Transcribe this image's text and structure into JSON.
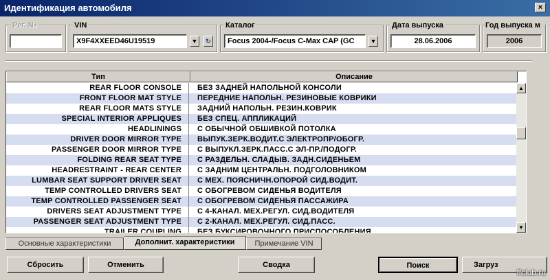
{
  "window": {
    "title": "Идентификация автомобиля",
    "close_glyph": "×"
  },
  "fields": {
    "reg_label": "Рег. №",
    "reg_value": "",
    "vin_label": "VIN",
    "vin_value": "X9F4XXEED46U19519",
    "catalog_label": "Каталог",
    "catalog_value": "Focus 2004-/Focus C-Max CAP (GC",
    "date_label": "Дата выпуска",
    "date_value": "28.06.2006",
    "year_label": "Год выпуска м",
    "year_value": "2006"
  },
  "grid": {
    "columns": [
      "Тип",
      "Описание"
    ],
    "rows": [
      [
        "REAR FLOOR CONSOLE",
        "БЕЗ ЗАДНЕЙ НАПОЛЬНОЙ КОНСОЛИ"
      ],
      [
        "FRONT FLOOR MAT STYLE",
        "ПЕРЕДНИЕ НАПОЛЬН. РЕЗИНОВЫЕ КОВРИКИ"
      ],
      [
        "REAR FLOOR MATS STYLE",
        "ЗАДНИЙ НАПОЛЬН. РЕЗИН.КОВРИК"
      ],
      [
        "SPECIAL INTERIOR APPLIQUES",
        "БЕЗ СПЕЦ. АППЛИКАЦИЙ"
      ],
      [
        "HEADLININGS",
        "С ОБЫЧНОЙ ОБШИВКОЙ ПОТОЛКА"
      ],
      [
        "DRIVER DOOR MIRROR TYPE",
        "ВЫПУК.ЗЕРК.ВОДИТ.С ЭЛЕКТРОПР/ОБОГР."
      ],
      [
        "PASSENGER DOOR MIRROR TYPE",
        "С ВЫПУКЛ.ЗЕРК.ПАСС.С ЭЛ-ПР./ПОДОГР."
      ],
      [
        "FOLDING REAR SEAT TYPE",
        "С РАЗДЕЛЬН. СЛАДЫВ. ЗАДН.СИДЕНЬЕМ"
      ],
      [
        "HEADRESTRAINT - REAR CENTER",
        "С ЗАДНИМ ЦЕНТРАЛЬН. ПОДГОЛОВНИКОМ"
      ],
      [
        "LUMBAR SEAT SUPPORT DRIVER SEAT",
        "С МЕХ. ПОЯСНИЧН.ОПОРОЙ СИД.ВОДИТ."
      ],
      [
        "TEMP CONTROLLED DRIVERS SEAT",
        "С ОБОГРЕВОМ СИДЕНЬЯ ВОДИТЕЛЯ"
      ],
      [
        "TEMP CONTROLLED PASSENGER SEAT",
        "С ОБОГРЕВОМ СИДЕНЬЯ ПАССАЖИРА"
      ],
      [
        "DRIVERS SEAT ADJUSTMENT TYPE",
        "С 4-КАНАЛ. МЕХ.РЕГУЛ. СИД.ВОДИТЕЛЯ"
      ],
      [
        "PASSENGER SEAT ADJUSTMENT TYPE",
        "С 2-КАНАЛ. МЕХ.РЕГУЛ. СИД.ПАСС."
      ],
      [
        "TRAILER COUPLING",
        "БЕЗ БУКСИРОВОЧНОГО ПРИСПОСОБЛЕНИЯ"
      ]
    ]
  },
  "tabs": [
    "Основные характеристики",
    "Дополнит. характеристики",
    "Примечание VIN"
  ],
  "buttons": {
    "reset": "Сбросить",
    "cancel": "Отменить",
    "summary": "Сводка",
    "search": "Поиск",
    "load": "Загруз"
  },
  "watermark": "ffclub.ru"
}
